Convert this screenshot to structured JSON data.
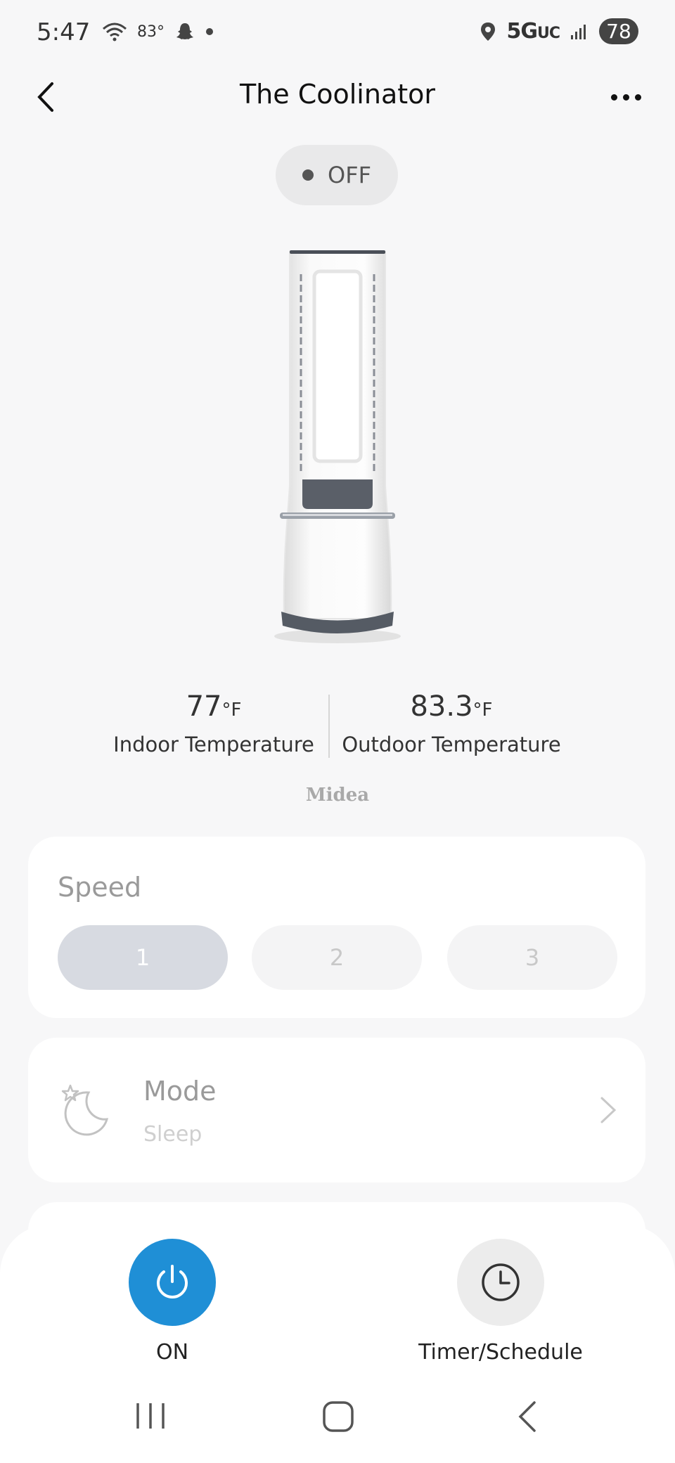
{
  "status_bar": {
    "time": "5:47",
    "temperature": "83°",
    "network_main": "5G",
    "network_sub": "UC",
    "battery": "78"
  },
  "header": {
    "title": "The Coolinator"
  },
  "device": {
    "state": "OFF"
  },
  "temperatures": {
    "indoor_value": "77",
    "indoor_unit": "°F",
    "indoor_label": "Indoor Temperature",
    "outdoor_value": "83.3",
    "outdoor_unit": "°F",
    "outdoor_label": "Outdoor Temperature"
  },
  "brand": "Midea",
  "speed": {
    "title": "Speed",
    "options": [
      "1",
      "2",
      "3"
    ],
    "selected": "1"
  },
  "mode": {
    "title": "Mode",
    "value": "Sleep"
  },
  "actions": {
    "power_label": "ON",
    "timer_label": "Timer/Schedule"
  },
  "colors": {
    "accent": "#1f8fd6",
    "background": "#f7f7f8"
  }
}
